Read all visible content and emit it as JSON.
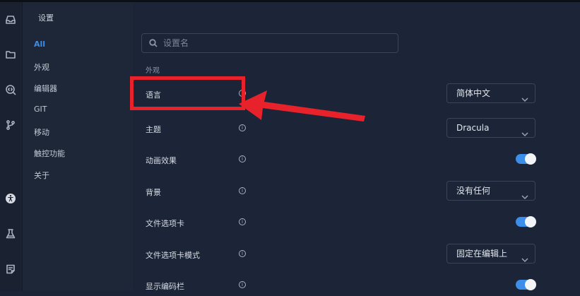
{
  "sidebar_rail": {
    "icons": [
      "inbox-icon",
      "folder-icon",
      "search-code-icon",
      "git-branch-icon",
      "accessibility-icon",
      "flask-icon",
      "note-icon"
    ]
  },
  "nav": {
    "title": "设置",
    "items": [
      {
        "label": "All",
        "active": true
      },
      {
        "label": "外观"
      },
      {
        "label": "编辑器"
      },
      {
        "label": "GIT"
      },
      {
        "label": "移动"
      },
      {
        "label": "触控功能"
      },
      {
        "label": "关于"
      }
    ]
  },
  "search": {
    "placeholder": "设置名",
    "value": ""
  },
  "section": {
    "label": "外观"
  },
  "settings": [
    {
      "label": "语言",
      "control": "select",
      "value": "简体中文"
    },
    {
      "label": "主题",
      "control": "select",
      "value": "Dracula"
    },
    {
      "label": "动画效果",
      "control": "toggle",
      "value": "on"
    },
    {
      "label": "背景",
      "control": "select",
      "value": "没有任何"
    },
    {
      "label": "文件选项卡",
      "control": "toggle",
      "value": "on"
    },
    {
      "label": "文件选项卡模式",
      "control": "select",
      "value": "固定在编辑上"
    },
    {
      "label": "显示编码栏",
      "control": "toggle",
      "value": "on"
    }
  ],
  "info_glyph": "i",
  "colors": {
    "accent": "#3c8ee8",
    "annotation": "#e8222a",
    "background": "#1b2537"
  }
}
